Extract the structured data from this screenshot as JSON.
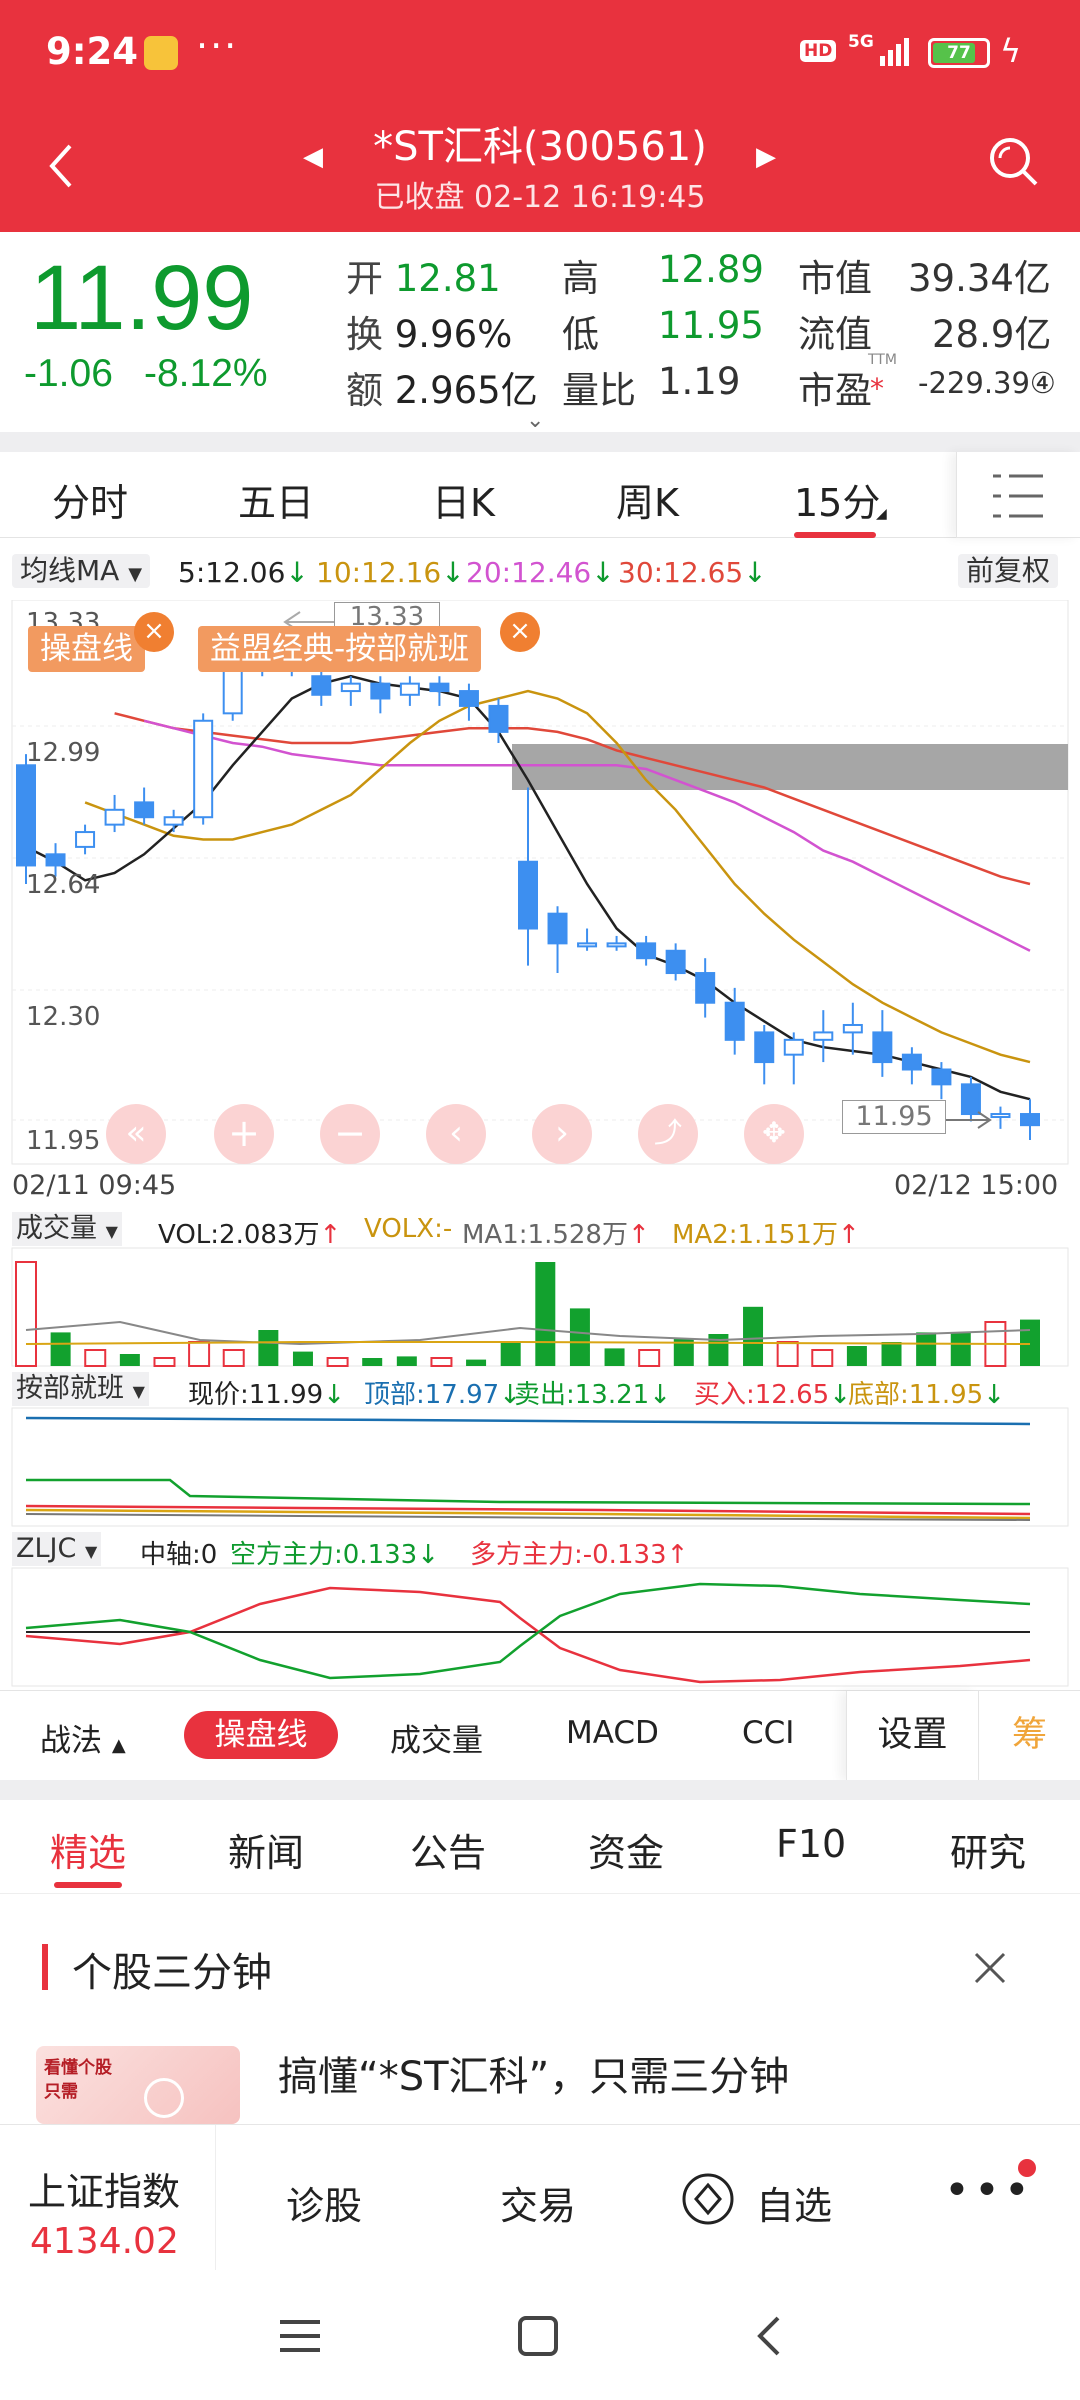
{
  "status_bar": {
    "time": "9:24",
    "hd": "HD",
    "network": "5G",
    "battery": "77"
  },
  "header": {
    "title": "*ST汇科(300561)",
    "subtitle": "已收盘   02-12 16:19:45"
  },
  "quote": {
    "price": "11.99",
    "change": "-1.06",
    "change_pct": "-8.12%",
    "col1": [
      {
        "label": "开",
        "value": "12.81"
      },
      {
        "label": "换",
        "value": "9.96%"
      },
      {
        "label": "额",
        "value": "2.965亿"
      }
    ],
    "col2": [
      {
        "label": "高",
        "value": "12.89"
      },
      {
        "label": "低",
        "value": "11.95"
      },
      {
        "label": "量比",
        "value": "1.19"
      }
    ],
    "col3": [
      {
        "label": "市值",
        "value": "39.34亿"
      },
      {
        "label": "流值",
        "value": "28.9亿"
      },
      {
        "label": "市盈",
        "value": "-229.39④"
      }
    ],
    "pe_sup": "TTM"
  },
  "period_tabs": [
    "分时",
    "五日",
    "日K",
    "周K",
    "15分"
  ],
  "ma_line": {
    "name": "均线MA",
    "items": [
      {
        "text": "5:12.06",
        "color": "#222222"
      },
      {
        "text": "10:12.16",
        "color": "#c9940f"
      },
      {
        "text": "20:12.46",
        "color": "#d253d0"
      },
      {
        "text": "30:12.65",
        "color": "#e0483a"
      }
    ],
    "adjust": "前复权"
  },
  "chart": {
    "y_labels": [
      "13.33",
      "12.99",
      "12.64",
      "12.30",
      "11.95"
    ],
    "high_label": "13.33",
    "low_label": "11.95",
    "date_start": "02/11 09:45",
    "date_end": "02/12 15:00",
    "tags": [
      "操盘线",
      "益盟经典-按部就班"
    ],
    "volume_panel": {
      "name": "成交量",
      "vol": "VOL:2.083万",
      "volx": "VOLX:-",
      "ma1": "MA1:1.528万",
      "ma2": "MA2:1.151万"
    },
    "abjb_panel": {
      "name": "按部就班",
      "now": "现价:11.99",
      "top": "顶部:17.97",
      "sell": "卖出:13.21",
      "buy": "买入:12.65",
      "bottom": "底部:11.95"
    },
    "zljc_panel": {
      "name": "ZLJC",
      "axis": "中轴:0",
      "short": "空方主力:0.133",
      "long": "多方主力:-0.133"
    }
  },
  "chart_data": {
    "type": "candlestick",
    "ylim": [
      11.95,
      13.33
    ],
    "candles": [
      {
        "o": 12.96,
        "c": 12.69,
        "h": 12.99,
        "l": 12.64
      },
      {
        "o": 12.72,
        "c": 12.69,
        "h": 12.75,
        "l": 12.66
      },
      {
        "o": 12.74,
        "c": 12.78,
        "h": 12.8,
        "l": 12.72
      },
      {
        "o": 12.8,
        "c": 12.84,
        "h": 12.88,
        "l": 12.78
      },
      {
        "o": 12.86,
        "c": 12.82,
        "h": 12.9,
        "l": 12.8
      },
      {
        "o": 12.8,
        "c": 12.82,
        "h": 12.84,
        "l": 12.78
      },
      {
        "o": 12.82,
        "c": 13.08,
        "h": 13.1,
        "l": 12.8
      },
      {
        "o": 13.1,
        "c": 13.22,
        "h": 13.28,
        "l": 13.08
      },
      {
        "o": 13.24,
        "c": 13.28,
        "h": 13.33,
        "l": 13.2
      },
      {
        "o": 13.26,
        "c": 13.24,
        "h": 13.28,
        "l": 13.2
      },
      {
        "o": 13.2,
        "c": 13.15,
        "h": 13.24,
        "l": 13.12
      },
      {
        "o": 13.16,
        "c": 13.18,
        "h": 13.2,
        "l": 13.12
      },
      {
        "o": 13.18,
        "c": 13.14,
        "h": 13.2,
        "l": 13.1
      },
      {
        "o": 13.15,
        "c": 13.18,
        "h": 13.2,
        "l": 13.12
      },
      {
        "o": 13.18,
        "c": 13.16,
        "h": 13.2,
        "l": 13.12
      },
      {
        "o": 13.16,
        "c": 13.12,
        "h": 13.18,
        "l": 13.08
      },
      {
        "o": 13.12,
        "c": 13.05,
        "h": 13.14,
        "l": 13.02
      },
      {
        "o": 12.7,
        "c": 12.52,
        "h": 12.9,
        "l": 12.42
      },
      {
        "o": 12.56,
        "c": 12.48,
        "h": 12.58,
        "l": 12.4
      },
      {
        "o": 12.48,
        "c": 12.48,
        "h": 12.52,
        "l": 12.46
      },
      {
        "o": 12.48,
        "c": 12.48,
        "h": 12.5,
        "l": 12.46
      },
      {
        "o": 12.48,
        "c": 12.44,
        "h": 12.5,
        "l": 12.42
      },
      {
        "o": 12.46,
        "c": 12.4,
        "h": 12.48,
        "l": 12.38
      },
      {
        "o": 12.4,
        "c": 12.32,
        "h": 12.44,
        "l": 12.28
      },
      {
        "o": 12.32,
        "c": 12.22,
        "h": 12.36,
        "l": 12.18
      },
      {
        "o": 12.24,
        "c": 12.16,
        "h": 12.26,
        "l": 12.1
      },
      {
        "o": 12.18,
        "c": 12.22,
        "h": 12.24,
        "l": 12.1
      },
      {
        "o": 12.22,
        "c": 12.24,
        "h": 12.3,
        "l": 12.16
      },
      {
        "o": 12.24,
        "c": 12.26,
        "h": 12.32,
        "l": 12.18
      },
      {
        "o": 12.24,
        "c": 12.16,
        "h": 12.3,
        "l": 12.12
      },
      {
        "o": 12.18,
        "c": 12.14,
        "h": 12.2,
        "l": 12.1
      },
      {
        "o": 12.14,
        "c": 12.1,
        "h": 12.16,
        "l": 12.06
      },
      {
        "o": 12.1,
        "c": 12.02,
        "h": 12.12,
        "l": 12.0
      },
      {
        "o": 12.02,
        "c": 12.02,
        "h": 12.04,
        "l": 11.98
      },
      {
        "o": 12.02,
        "c": 11.99,
        "h": 12.06,
        "l": 11.95
      }
    ],
    "ma5": [
      12.74,
      12.7,
      12.65,
      12.67,
      12.72,
      12.79,
      12.86,
      12.96,
      13.05,
      13.14,
      13.18,
      13.2,
      13.18,
      13.17,
      13.16,
      13.14,
      13.05,
      12.92,
      12.78,
      12.64,
      12.52,
      12.45,
      12.42,
      12.38,
      12.32,
      12.27,
      12.22,
      12.2,
      12.19,
      12.18,
      12.16,
      12.14,
      12.12,
      12.08,
      12.06
    ],
    "ma10": [
      12.86,
      12.83,
      12.8,
      12.77,
      12.76,
      12.76,
      12.78,
      12.8,
      12.84,
      12.88,
      12.95,
      13.02,
      13.08,
      13.12,
      13.14,
      13.16,
      13.14,
      13.1,
      13.02,
      12.92,
      12.84,
      12.74,
      12.64,
      12.56,
      12.49,
      12.43,
      12.37,
      12.32,
      12.28,
      12.24,
      12.21,
      12.18,
      12.16
    ],
    "ma20": [
      13.08,
      13.06,
      13.04,
      13.02,
      13.01,
      12.99,
      12.98,
      12.97,
      12.96,
      12.96,
      12.96,
      12.96,
      12.96,
      12.96,
      12.96,
      12.96,
      12.96,
      12.95,
      12.92,
      12.89,
      12.86,
      12.82,
      12.78,
      12.73,
      12.7,
      12.66,
      12.62,
      12.58,
      12.54,
      12.5,
      12.46
    ],
    "ma30": [
      13.1,
      13.08,
      13.06,
      13.05,
      13.04,
      13.03,
      13.02,
      13.02,
      13.02,
      13.03,
      13.04,
      13.05,
      13.06,
      13.06,
      13.06,
      13.05,
      13.03,
      13.0,
      12.98,
      12.96,
      12.94,
      12.92,
      12.9,
      12.87,
      12.84,
      12.81,
      12.78,
      12.75,
      12.72,
      12.69,
      12.66,
      12.64
    ],
    "volume": [
      -1.3,
      0.42,
      -0.2,
      0.15,
      -0.1,
      -0.3,
      -0.2,
      0.45,
      0.18,
      -0.1,
      0.1,
      0.12,
      -0.1,
      0.08,
      0.3,
      1.3,
      0.72,
      0.22,
      -0.2,
      0.35,
      0.4,
      0.74,
      -0.3,
      -0.2,
      0.25,
      0.3,
      0.42,
      0.42,
      -0.55,
      0.58
    ]
  },
  "chart_tools": {
    "tactics": "战法",
    "indicators": [
      "操盘线",
      "成交量",
      "MACD",
      "CCI"
    ],
    "settings": "设置",
    "chip": "筹"
  },
  "content_tabs": [
    "精选",
    "新闻",
    "公告",
    "资金",
    "F10",
    "研究"
  ],
  "news": {
    "section_title": "个股三分钟",
    "headline": "搞懂“*ST汇科”，只需三分钟",
    "thumb_text": "看懂个股\n只需"
  },
  "bottom_nav": {
    "index_name": "上证指数",
    "index_value": "4134.02",
    "items": [
      "诊股",
      "交易",
      "自选"
    ]
  }
}
